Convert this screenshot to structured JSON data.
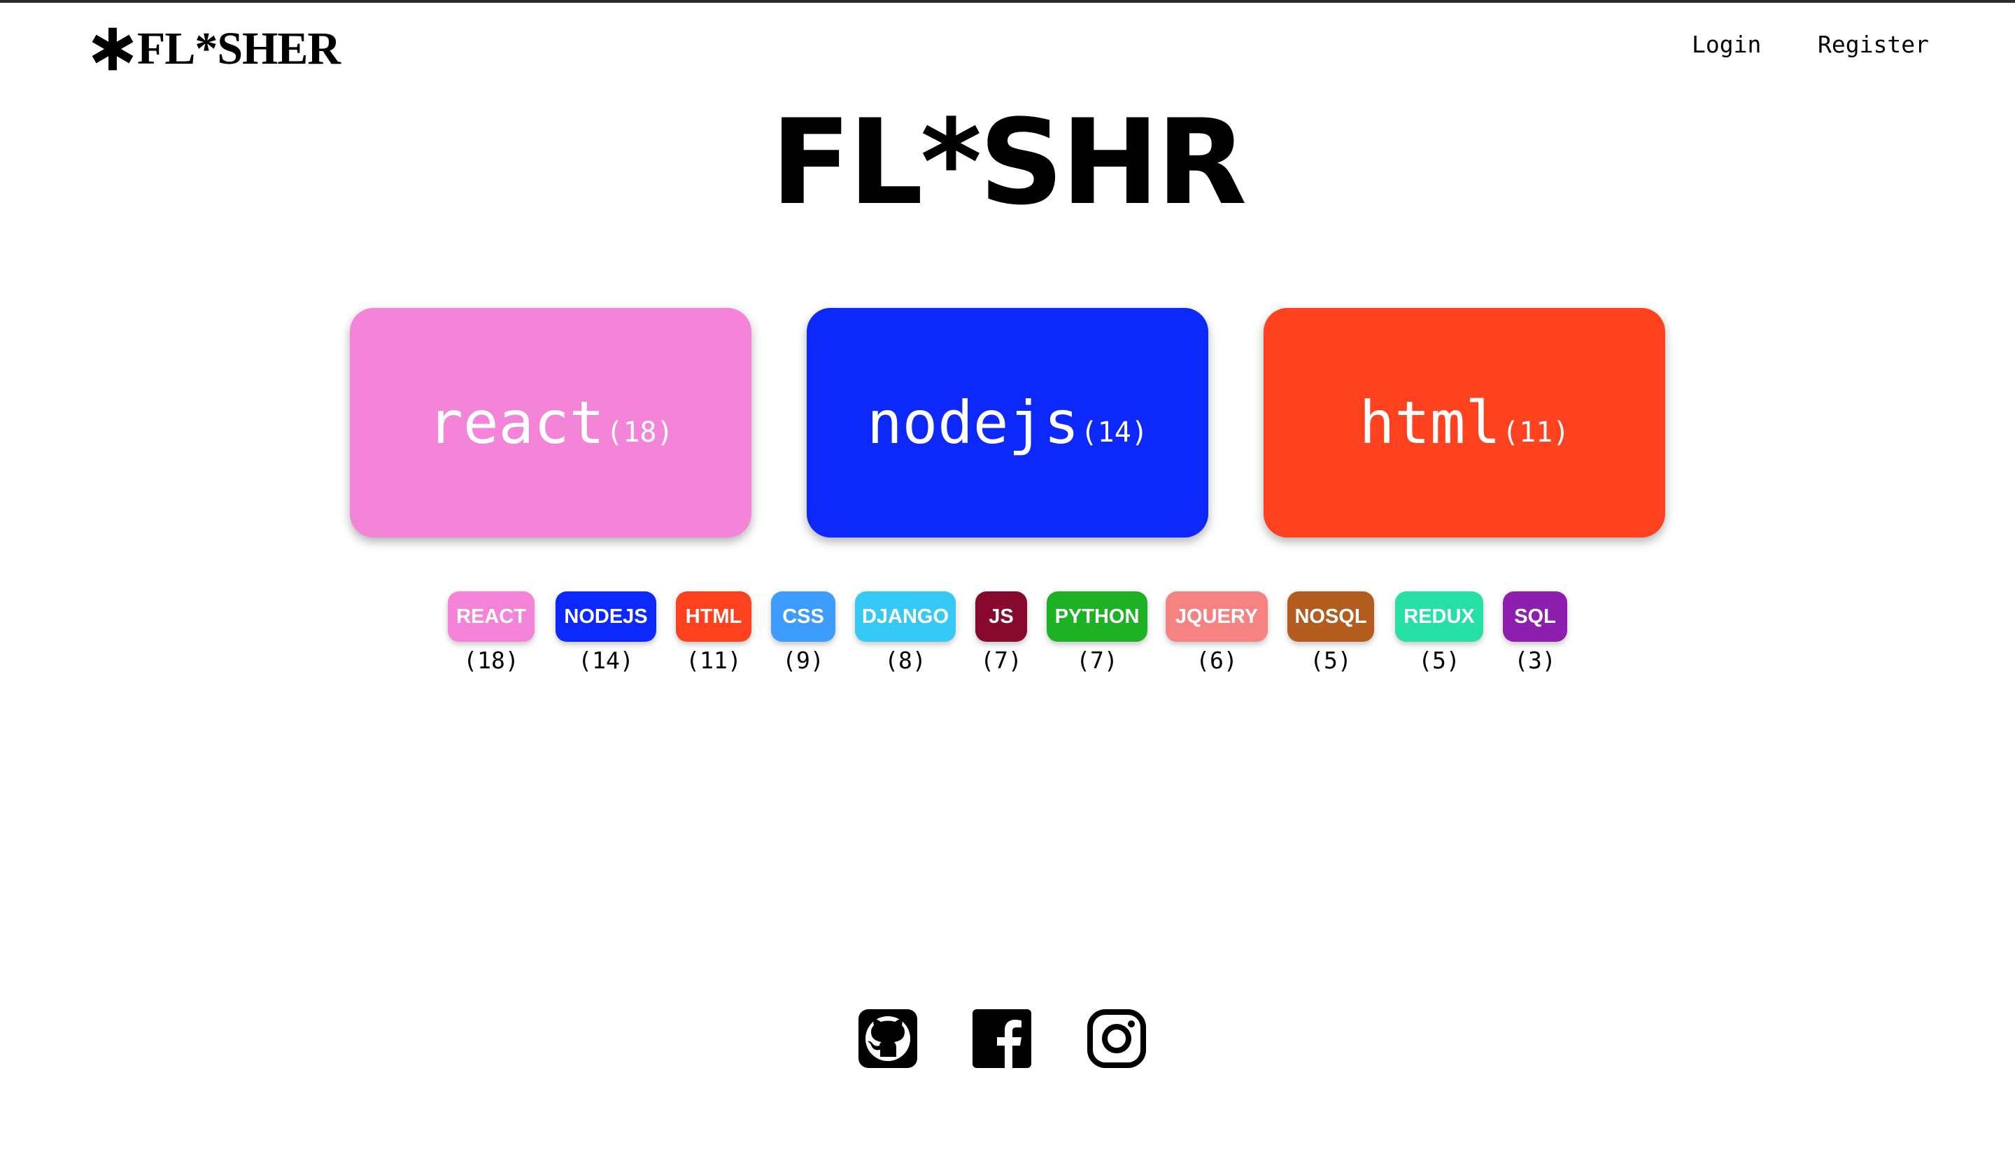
{
  "header": {
    "brand": "FL*SHER",
    "nav": {
      "login": "Login",
      "register": "Register"
    }
  },
  "hero": {
    "title": "FL*SHR"
  },
  "featured": [
    {
      "name": "react",
      "count": "(18)",
      "color": "#F484D7"
    },
    {
      "name": "nodejs",
      "count": "(14)",
      "color": "#0D28FB"
    },
    {
      "name": "html",
      "count": "(11)",
      "color": "#FE411E"
    }
  ],
  "tags": [
    {
      "label": "REACT",
      "count": "(18)",
      "color": "#F484D7"
    },
    {
      "label": "NODEJS",
      "count": "(14)",
      "color": "#0D28FB"
    },
    {
      "label": "HTML",
      "count": "(11)",
      "color": "#FE411E"
    },
    {
      "label": "CSS",
      "count": "(9)",
      "color": "#3E9DFC"
    },
    {
      "label": "DJANGO",
      "count": "(8)",
      "color": "#37C9F5"
    },
    {
      "label": "JS",
      "count": "(7)",
      "color": "#870A2E"
    },
    {
      "label": "PYTHON",
      "count": "(7)",
      "color": "#1EB025"
    },
    {
      "label": "JQUERY",
      "count": "(6)",
      "color": "#F48382"
    },
    {
      "label": "NOSQL",
      "count": "(5)",
      "color": "#B35C1F"
    },
    {
      "label": "REDUX",
      "count": "(5)",
      "color": "#28E0A6"
    },
    {
      "label": "SQL",
      "count": "(3)",
      "color": "#8E1EAE"
    }
  ],
  "footer": {
    "icons": [
      "github-icon",
      "facebook-icon",
      "instagram-icon"
    ]
  }
}
